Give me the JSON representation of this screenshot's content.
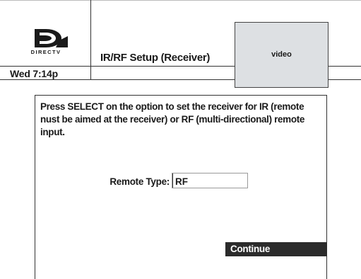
{
  "header": {
    "brand": "DIRECTV",
    "logo_icon": "directv-logo-icon",
    "title": "IR/RF Setup (Receiver)",
    "clock": "Wed 7:14p",
    "video_label": "video",
    "video_bg": "#dde0e3"
  },
  "main": {
    "instructions": "Press SELECT on the option to set the receiver for IR (remote nust be aimed at the receiver) or RF (multi-directional) remote input.",
    "remote_type_label": "Remote Type:",
    "remote_type_value": "RF",
    "continue_label": "Continue",
    "continue_bg": "#2b2b2b"
  }
}
